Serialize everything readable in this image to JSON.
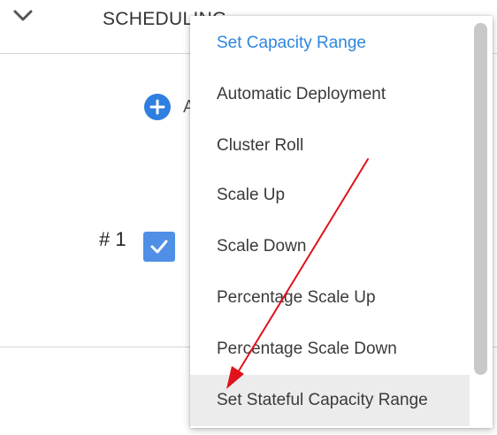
{
  "header": {
    "section_title": "SCHEDULING",
    "collapse_icon": "chevron-down-icon"
  },
  "content": {
    "add_button_label": "Add",
    "add_icon": "plus-circle-icon",
    "row_number": "# 1",
    "row_checked": true
  },
  "dropdown": {
    "selected_index": 0,
    "hovered_index": 7,
    "items": [
      {
        "label": "Set Capacity Range"
      },
      {
        "label": "Automatic Deployment"
      },
      {
        "label": "Cluster Roll"
      },
      {
        "label": "Scale Up"
      },
      {
        "label": "Scale Down"
      },
      {
        "label": "Percentage Scale Up"
      },
      {
        "label": "Percentage Scale Down"
      },
      {
        "label": "Set Stateful Capacity Range"
      }
    ]
  },
  "colors": {
    "accent": "#2e86de",
    "arrow": "#e0121b",
    "hover_bg": "#ececec",
    "checkbox": "#4f8fe6"
  }
}
